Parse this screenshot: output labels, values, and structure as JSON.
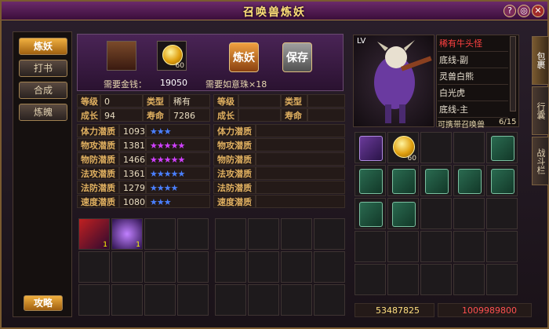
{
  "title": "召唤兽炼妖",
  "left_tabs": [
    "炼妖",
    "打书",
    "合成",
    "炼魄"
  ],
  "strategy_btn": "攻略",
  "header": {
    "money_label": "需要金钱：",
    "money_value": "19050",
    "coin_count": "60",
    "pearl_label": "需要如意珠×18",
    "refine_btn": "炼妖",
    "save_btn": "保存"
  },
  "stats_left": {
    "level_lbl": "等级",
    "level": "0",
    "type_lbl": "类型",
    "type": "稀有",
    "growth_lbl": "成长",
    "growth": "94",
    "life_lbl": "寿命",
    "life": "7286"
  },
  "stats_right": {
    "level_lbl": "等级",
    "level": "",
    "type_lbl": "类型",
    "type": "",
    "growth_lbl": "成长",
    "growth": "",
    "life_lbl": "寿命",
    "life": ""
  },
  "aptitudes": [
    {
      "name": "体力潜质",
      "value": "1093",
      "stars": "★★★",
      "color": "blue"
    },
    {
      "name": "物攻潜质",
      "value": "1381",
      "stars": "★★★★★",
      "color": "purple"
    },
    {
      "name": "物防潜质",
      "value": "1466",
      "stars": "★★★★★",
      "color": "purple"
    },
    {
      "name": "法攻潜质",
      "value": "1361",
      "stars": "★★★★★",
      "color": "blue"
    },
    {
      "name": "法防潜质",
      "value": "1279",
      "stars": "★★★★",
      "color": "blue"
    },
    {
      "name": "速度潜质",
      "value": "1080",
      "stars": "★★★",
      "color": "blue"
    }
  ],
  "skill_counts": [
    "1",
    "1"
  ],
  "pet_list": [
    "稀有牛头怪",
    "底线-副",
    "灵兽白熊",
    "白光虎",
    "底线-主"
  ],
  "pet_level_lbl": "LV",
  "carry_label": "可携带召唤兽",
  "carry_count": "6/15",
  "bag_coin_count": "60",
  "right_tabs": [
    "包裹",
    "行囊",
    "战斗栏"
  ],
  "money_bottom": "53487825",
  "gold_bottom": "1009989800"
}
